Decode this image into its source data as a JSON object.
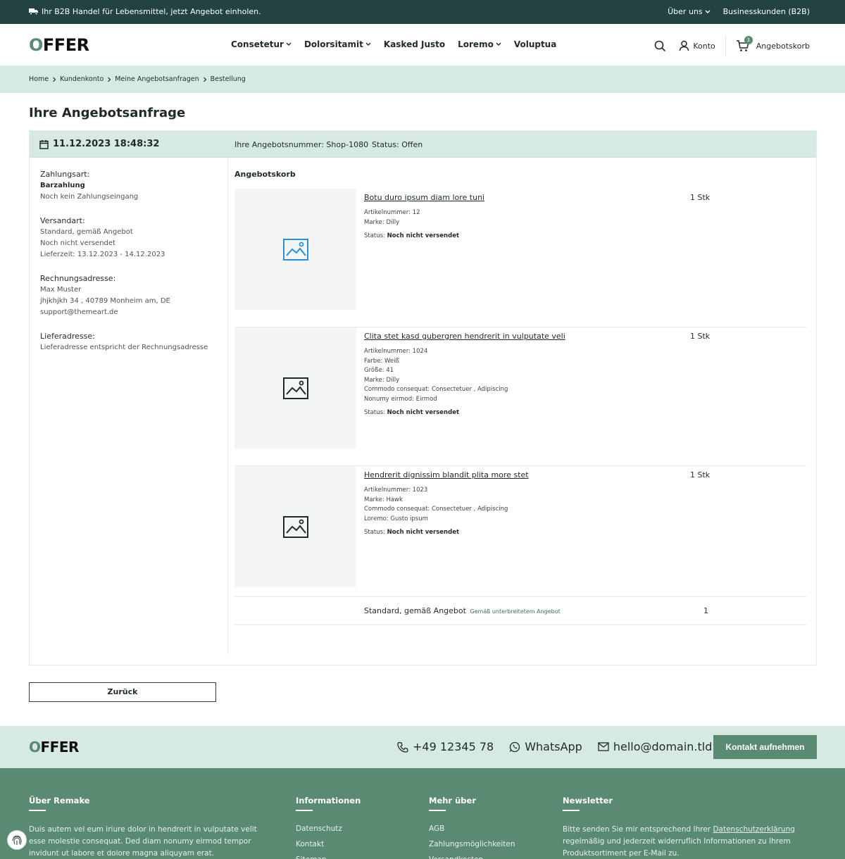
{
  "topbar": {
    "promo": "Ihr B2B Handel für Lebensmittel, jetzt Angebot einholen.",
    "links": [
      "Über uns",
      "Businesskunden (B2B)"
    ]
  },
  "header": {
    "logo": "OFFER",
    "nav": [
      {
        "label": "Consetetur",
        "dropdown": true
      },
      {
        "label": "Dolorsitamit",
        "dropdown": true
      },
      {
        "label": "Kasked Justo",
        "dropdown": false
      },
      {
        "label": "Loremo",
        "dropdown": true
      },
      {
        "label": "Voluptua",
        "dropdown": false
      }
    ],
    "account": "Konto",
    "cart_label": "Angebotskorb",
    "cart_count": "3"
  },
  "breadcrumb": [
    "Home",
    "Kundenkonto",
    "Meine Angebotsanfragen",
    "Bestellung"
  ],
  "page_title": "Ihre Angebotsanfrage",
  "order": {
    "datetime": "11.12.2023 18:48:32",
    "number": "Ihre Angebotsnummer: Shop-1080",
    "status": "Status: Offen",
    "payment": {
      "label": "Zahlungsart:",
      "method": "Barzahlung",
      "state": "Noch kein Zahlungseingang"
    },
    "shipping": {
      "label": "Versandart:",
      "method": "Standard, gemäß Angebot",
      "state": "Noch nicht versendet",
      "delivery": "Lieferzeit: 13.12.2023 - 14.12.2023"
    },
    "billing": {
      "label": "Rechnungsadresse:",
      "name": "Max Muster",
      "street": "jhjkhjkh 34 , 40789 Monheim am, DE",
      "email": "support@themeart.de"
    },
    "delivery_address": {
      "label": "Lieferadresse:",
      "text": "Lieferadresse entspricht der Rechnungsadresse"
    },
    "cart_title": "Angebotskorb",
    "items": [
      {
        "title": "Botu duro ipsum diam lore tuni",
        "qty": "1 Stk",
        "attributes": [
          "Artikelnummer: 12",
          "Marke: Dilly"
        ],
        "status_label": "Status:",
        "status": "Noch nicht versendet",
        "icon_color": "#2b8fd6"
      },
      {
        "title": "Clita stet kasd gubergren hendrerit in vulputate veli",
        "qty": "1 Stk",
        "attributes": [
          "Artikelnummer: 1024",
          "Farbe: Weiß",
          "Größe: 41",
          "Marke: Dilly",
          "Commodo consequat: Consectetuer , Adipiscing",
          "Nonumy eirmod: Eirmod"
        ],
        "status_label": "Status:",
        "status": "Noch nicht versendet",
        "icon_color": "#1f2a2a"
      },
      {
        "title": "Hendrerit dignissim blandit plita more stet",
        "qty": "1 Stk",
        "attributes": [
          "Artikelnummer: 1023",
          "Marke: Hawk",
          "Commodo consequat: Consectetuer , Adipiscing",
          "Loremo: Gusto ipsum"
        ],
        "status_label": "Status:",
        "status": "Noch nicht versendet",
        "icon_color": "#1f2a2a"
      }
    ],
    "shipping_row": {
      "name": "Standard, gemäß Angebot",
      "note": "Gemäß unterbreitetem Angebot",
      "qty": "1"
    }
  },
  "back_button": "Zurück",
  "footer": {
    "logo": "OFFER",
    "phone": "+49 12345 78",
    "whatsapp": "WhatsApp",
    "email": "hello@domain.tld",
    "contact_button": "Kontakt aufnehmen",
    "about": {
      "title": "Über Remake",
      "text": "Duis autem vel eum iriure dolor in hendrerit in vulputate velit esse molestie consequat. Ded diam nonumy eirmod tempor invidunt ut labore et dolore magna aliquyam erat."
    },
    "info": {
      "title": "Informationen",
      "links": [
        "Datenschutz",
        "Kontakt",
        "Sitemap"
      ]
    },
    "more": {
      "title": "Mehr über",
      "links": [
        "AGB",
        "Zahlungsmöglichkeiten",
        "Versandkosten"
      ]
    },
    "newsletter": {
      "title": "Newsletter",
      "text_before": "Bitte senden Sie mir entsprechend Ihrer ",
      "link": "Datenschutzerklärung",
      "text_after": " regelmäßig und jederzeit widerruflich Informationen zu Ihrem Produktsortiment per E-Mail zu."
    }
  }
}
